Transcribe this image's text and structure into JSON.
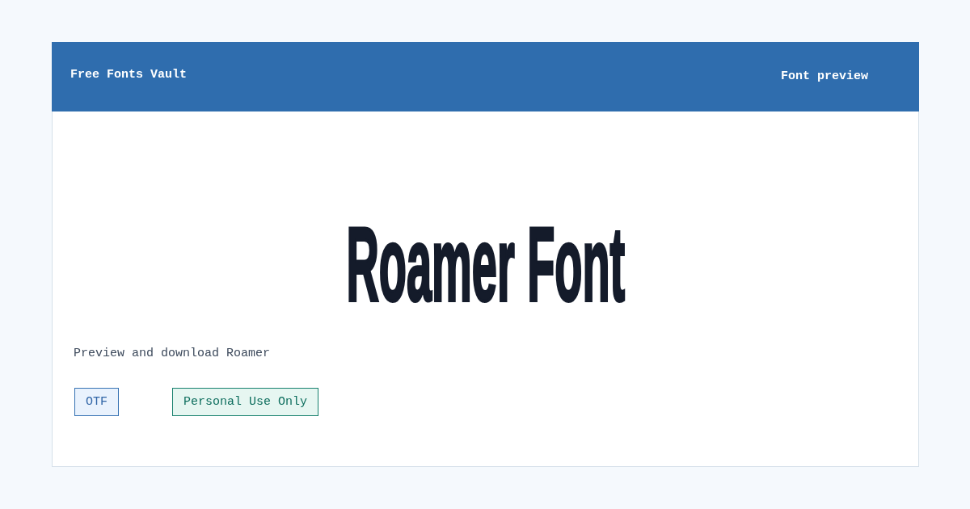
{
  "header": {
    "brand": "Free Fonts Vault",
    "nav_link": "Font preview"
  },
  "preview": {
    "title": "Roamer Font",
    "subtitle": "Preview and download Roamer"
  },
  "tags": [
    {
      "label": "OTF",
      "kind": "format"
    },
    {
      "label": "Personal Use Only",
      "kind": "license"
    }
  ]
}
